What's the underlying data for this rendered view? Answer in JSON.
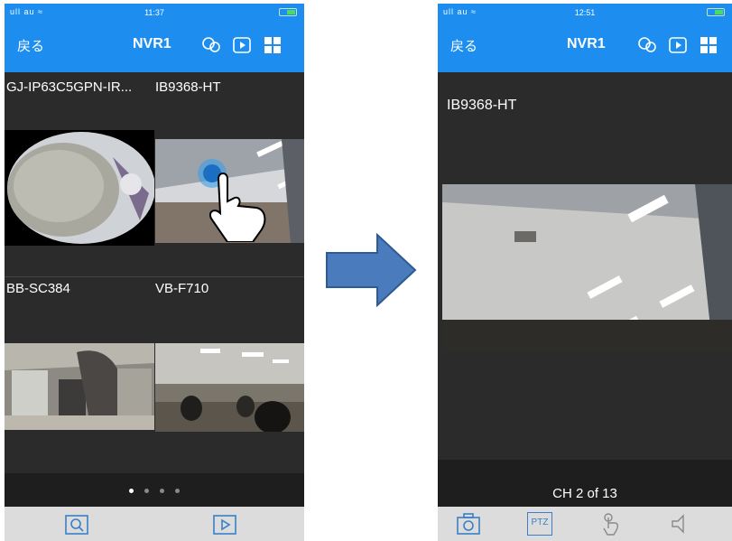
{
  "left_screen": {
    "status": {
      "signal": "ull au ≈",
      "time": "11:37"
    },
    "nav": {
      "back_label": "戻る",
      "title": "NVR1"
    },
    "cameras": [
      {
        "label": "GJ-IP63C5GPN-IR..."
      },
      {
        "label": "IB9368-HT"
      },
      {
        "label": "BB-SC384"
      },
      {
        "label": "VB-F710"
      }
    ],
    "page_indicator": {
      "total": 4,
      "active": 1
    },
    "tabbar": {
      "icons": [
        "search-playback-icon",
        "playback-icon"
      ]
    }
  },
  "transition": {
    "icon": "arrow-right-icon",
    "color": "#4a7bbd"
  },
  "right_screen": {
    "status": {
      "signal": "ull au ≈",
      "time": "12:51"
    },
    "nav": {
      "back_label": "戻る",
      "title": "NVR1"
    },
    "camera_label": "IB9368-HT",
    "channel_text": "CH 2 of 13",
    "tabbar": {
      "icons": [
        "snapshot-icon",
        "ptz-icon",
        "touch-icon",
        "speaker-icon"
      ],
      "ptz_label": "PTZ"
    }
  },
  "colors": {
    "accent": "#1d8ef0",
    "background": "#2b2b2b",
    "tabbar": "#dcdcdc",
    "touch_ring": "#3aa0e8"
  }
}
